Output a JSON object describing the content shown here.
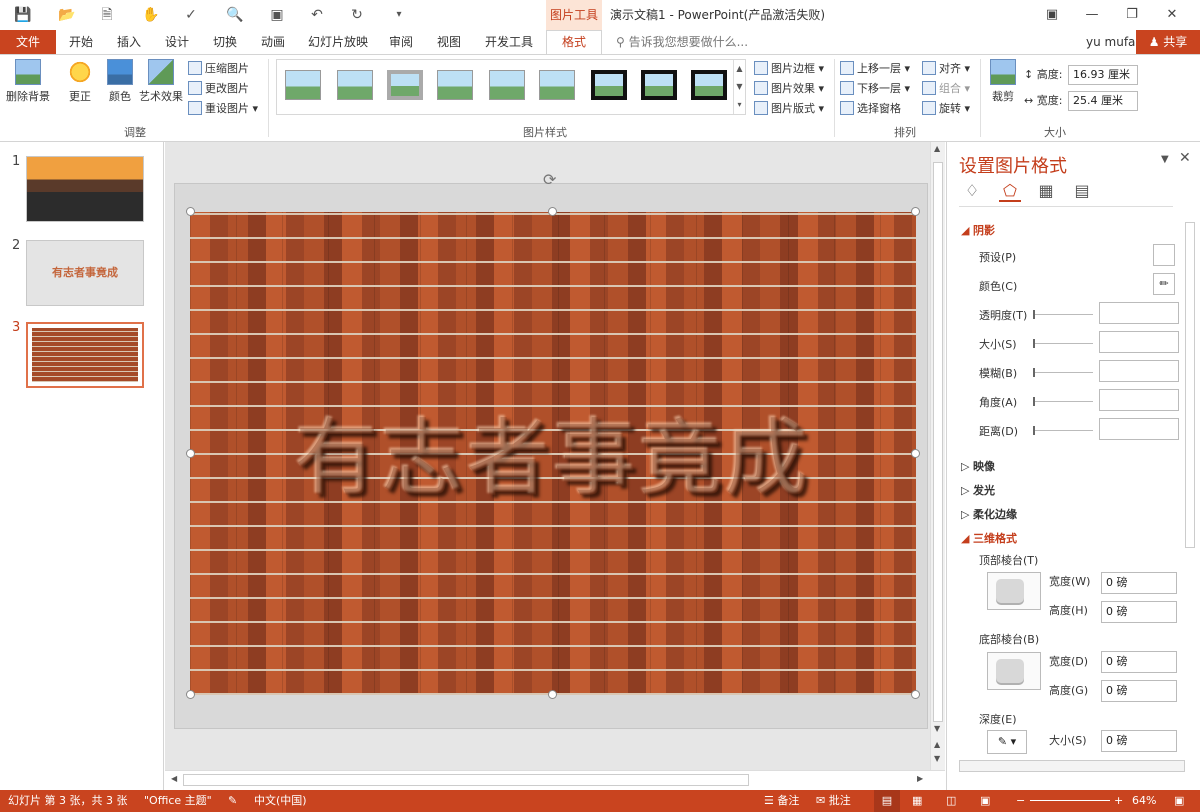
{
  "titlebar": {
    "context_tab": "图片工具",
    "doc_title": "演示文稿1 - PowerPoint(产品激活失败)"
  },
  "tabs": {
    "file": "文件",
    "items": [
      "开始",
      "插入",
      "设计",
      "切换",
      "动画",
      "幻灯片放映",
      "审阅",
      "视图",
      "开发工具"
    ],
    "active": "格式",
    "tellme": "告诉我您想要做什么...",
    "user": "yu mufa",
    "share": "共享"
  },
  "ribbon": {
    "remove_bg": "删除背景",
    "correct": "更正",
    "color": "颜色",
    "artistic": "艺术效果",
    "compress": "压缩图片",
    "change": "更改图片",
    "reset": "重设图片",
    "group_adjust": "调整",
    "group_styles": "图片样式",
    "border": "图片边框",
    "effects": "图片效果",
    "layout": "图片版式",
    "bring_forward": "上移一层",
    "send_backward": "下移一层",
    "selection_pane": "选择窗格",
    "align": "对齐",
    "group": "组合",
    "rotate": "旋转",
    "group_arrange": "排列",
    "crop": "裁剪",
    "height_label": "高度:",
    "height_value": "16.93 厘米",
    "width_label": "宽度:",
    "width_value": "25.4 厘米",
    "group_size": "大小"
  },
  "slides": {
    "numbers": [
      "1",
      "2",
      "3"
    ],
    "slide2_text": "有志者事竟成"
  },
  "canvas": {
    "wordart": "有志者事竟成"
  },
  "pane": {
    "title": "设置图片格式",
    "shadow": "阴影",
    "preset": "预设(P)",
    "color": "颜色(C)",
    "transparency": "透明度(T)",
    "size": "大小(S)",
    "blur": "模糊(B)",
    "angle": "角度(A)",
    "distance": "距离(D)",
    "reflection": "映像",
    "glow": "发光",
    "soft_edges": "柔化边缘",
    "format_3d": "三维格式",
    "top_bevel": "顶部棱台(T)",
    "bottom_bevel": "底部棱台(B)",
    "width_w": "宽度(W)",
    "height_h": "高度(H)",
    "width_d": "宽度(D)",
    "height_g": "高度(G)",
    "val_0": "0 磅",
    "depth": "深度(E)",
    "size_s": "大小(S)"
  },
  "status": {
    "slide_info": "幻灯片 第 3 张，共 3 张",
    "theme": "\"Office 主题\"",
    "lang": "中文(中国)",
    "notes": "备注",
    "comments": "批注",
    "zoom": "64%"
  },
  "colors": {
    "accent": "#c9441f",
    "accent_text": "#c43e1c",
    "context_bg": "#fce4d6"
  }
}
